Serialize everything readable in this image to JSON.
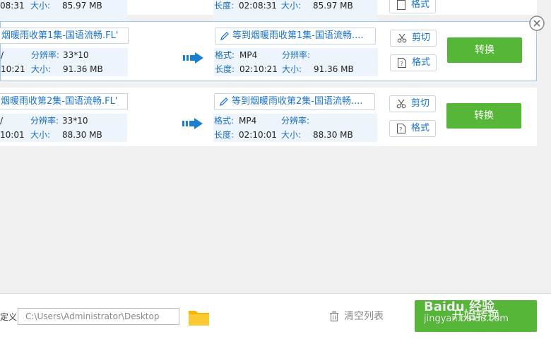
{
  "rows": [
    {
      "src_info": {
        "format_val": "",
        "size_label": "大小:",
        "size_val": "85.97 MB",
        "duration_val": "08:31",
        "resolution_label": "",
        "resolution_val": ""
      },
      "dst_info": {
        "duration_label": "长度:",
        "duration_val": "02:08:31",
        "size_label": "大小:",
        "size_val": "85.97 MB"
      },
      "format_btn": "格式"
    },
    {
      "src_name": "烟暖雨收第1集-国语流畅.FL'",
      "src_info": {
        "format_val": "/",
        "resolution_label": "分辨率:",
        "resolution_val": "33*10",
        "duration_val": "10:21",
        "size_label": "大小:",
        "size_val": "91.36 MB"
      },
      "dst_name": "等到烟暖雨收第1集-国语流畅....",
      "dst_info": {
        "format_label": "格式:",
        "format_val": "MP4",
        "resolution_label": "分辨率:",
        "duration_label": "长度:",
        "duration_val": "02:10:21",
        "size_label": "大小:",
        "size_val": "91.36 MB"
      },
      "cut_btn": "剪切",
      "format_btn": "格式",
      "convert_btn": "转换"
    },
    {
      "src_name": "烟暖雨收第2集-国语流畅.FL'",
      "src_info": {
        "format_val": "/",
        "resolution_label": "分辨率:",
        "resolution_val": "33*10",
        "duration_val": "10:01",
        "size_label": "大小:",
        "size_val": "88.30 MB"
      },
      "dst_name": "等到烟暖雨收第2集-国语流畅....",
      "dst_info": {
        "format_label": "格式:",
        "format_val": "MP4",
        "resolution_label": "分辨率:",
        "duration_label": "长度:",
        "duration_val": "02:10:01",
        "size_label": "大小:",
        "size_val": "88.30 MB"
      },
      "cut_btn": "剪切",
      "format_btn": "格式",
      "convert_btn": "转换"
    }
  ],
  "bottom": {
    "path_label": "定义",
    "path_value": "C:\\Users\\Administrator\\Desktop",
    "clear_list": "清空列表",
    "convert_all": "开始转换"
  },
  "watermark": {
    "brand": "Baidu 经验",
    "url": "jingyan.baidu.com"
  },
  "colors": {
    "accent_blue": "#1a73c7",
    "green": "#56b637",
    "info_bg": "#eef4fb"
  },
  "icons": [
    "close-icon",
    "pen-icon",
    "scissors-icon",
    "format-icon",
    "convert-arrow-icon",
    "folder-icon",
    "trash-icon"
  ]
}
